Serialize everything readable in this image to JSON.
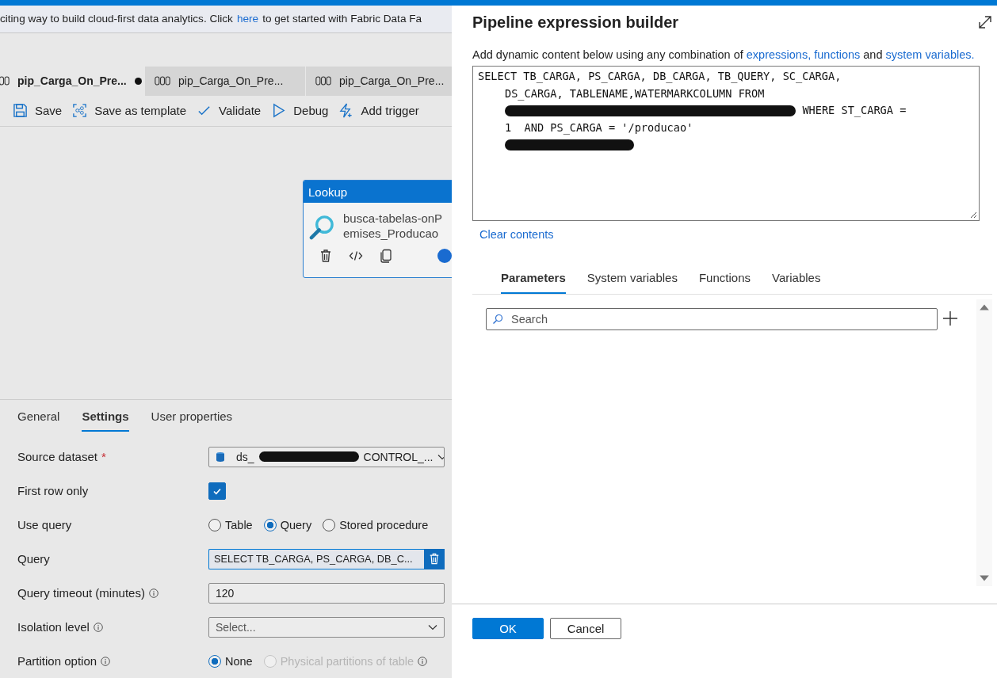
{
  "banner": {
    "before": "citing way to build cloud-first data analytics. Click",
    "link": "here",
    "after": "to get started with Fabric Data Fa"
  },
  "tabs": [
    {
      "label": "pip_Carga_On_Pre...",
      "selected": true,
      "modified": true
    },
    {
      "label": "pip_Carga_On_Pre...",
      "selected": false,
      "modified": false
    },
    {
      "label": "pip_Carga_On_Pre...",
      "selected": false,
      "modified": false
    }
  ],
  "toolbar": [
    {
      "kind": "save",
      "label": "Save"
    },
    {
      "kind": "template",
      "label": "Save as template"
    },
    {
      "kind": "validate",
      "label": "Validate"
    },
    {
      "kind": "debug",
      "label": "Debug"
    },
    {
      "kind": "trigger",
      "label": "Add trigger"
    }
  ],
  "activity": {
    "type_label": "Lookup",
    "name_lines": [
      "busca-tabelas-onP",
      "emises_Producao"
    ]
  },
  "bottom_tabs": [
    {
      "label": "General",
      "selected": false
    },
    {
      "label": "Settings",
      "selected": true
    },
    {
      "label": "User properties",
      "selected": false
    }
  ],
  "settings": [
    {
      "kind": "dataset",
      "label": "Source dataset",
      "required": "*",
      "segments": [
        {
          "kind": "text",
          "text": "ds_"
        },
        {
          "kind": "redacted"
        },
        {
          "kind": "text",
          "text": "CONTROL_..."
        }
      ]
    },
    {
      "kind": "checkbox",
      "label": "First row only",
      "checked": true
    },
    {
      "kind": "radio",
      "label": "Use query",
      "options": [
        {
          "label": "Table",
          "selected": false
        },
        {
          "label": "Query",
          "selected": true
        },
        {
          "label": "Stored procedure",
          "selected": false
        }
      ]
    },
    {
      "kind": "query",
      "label": "Query",
      "value": "SELECT TB_CARGA, PS_CARGA, DB_C..."
    },
    {
      "kind": "input",
      "label": "Query timeout (minutes)",
      "info": true,
      "value": "120"
    },
    {
      "kind": "select",
      "label": "Isolation level",
      "info": true,
      "placeholder": "Select..."
    },
    {
      "kind": "radio",
      "label": "Partition option",
      "info": true,
      "options": [
        {
          "label": "None",
          "selected": true
        },
        {
          "label": "Physical partitions of table",
          "selected": false,
          "disabled": true,
          "info": true
        }
      ]
    }
  ],
  "dialog": {
    "title": "Pipeline expression builder",
    "description": [
      {
        "kind": "text",
        "text": "Add dynamic content below using any combination of"
      },
      {
        "kind": "link",
        "text": "expressions, functions"
      },
      {
        "kind": "text",
        "text": "and"
      },
      {
        "kind": "link",
        "text": "system variables."
      }
    ],
    "expression_lines": [
      [
        {
          "kind": "text",
          "text": "SELECT TB_CARGA, PS_CARGA, DB_CARGA, TB_QUERY, SC_CARGA,"
        }
      ],
      [
        {
          "kind": "text",
          "text": "DS_CARGA, TABLENAME,WATERMARKCOLUMN FROM"
        }
      ],
      [
        {
          "kind": "redacted"
        },
        {
          "kind": "text",
          "text": "WHERE ST_CARGA ="
        }
      ],
      [
        {
          "kind": "text",
          "text": "1  AND PS_CARGA = '/producao'"
        }
      ],
      [
        {
          "kind": "redacted"
        }
      ]
    ],
    "clear_link": "Clear contents",
    "tabs": [
      {
        "label": "Parameters",
        "selected": true
      },
      {
        "label": "System variables",
        "selected": false
      },
      {
        "label": "Functions",
        "selected": false
      },
      {
        "label": "Variables",
        "selected": false
      }
    ],
    "search_placeholder": "Search",
    "buttons": [
      {
        "kind": "primary",
        "label": "OK"
      },
      {
        "kind": "secondary",
        "label": "Cancel"
      }
    ]
  }
}
